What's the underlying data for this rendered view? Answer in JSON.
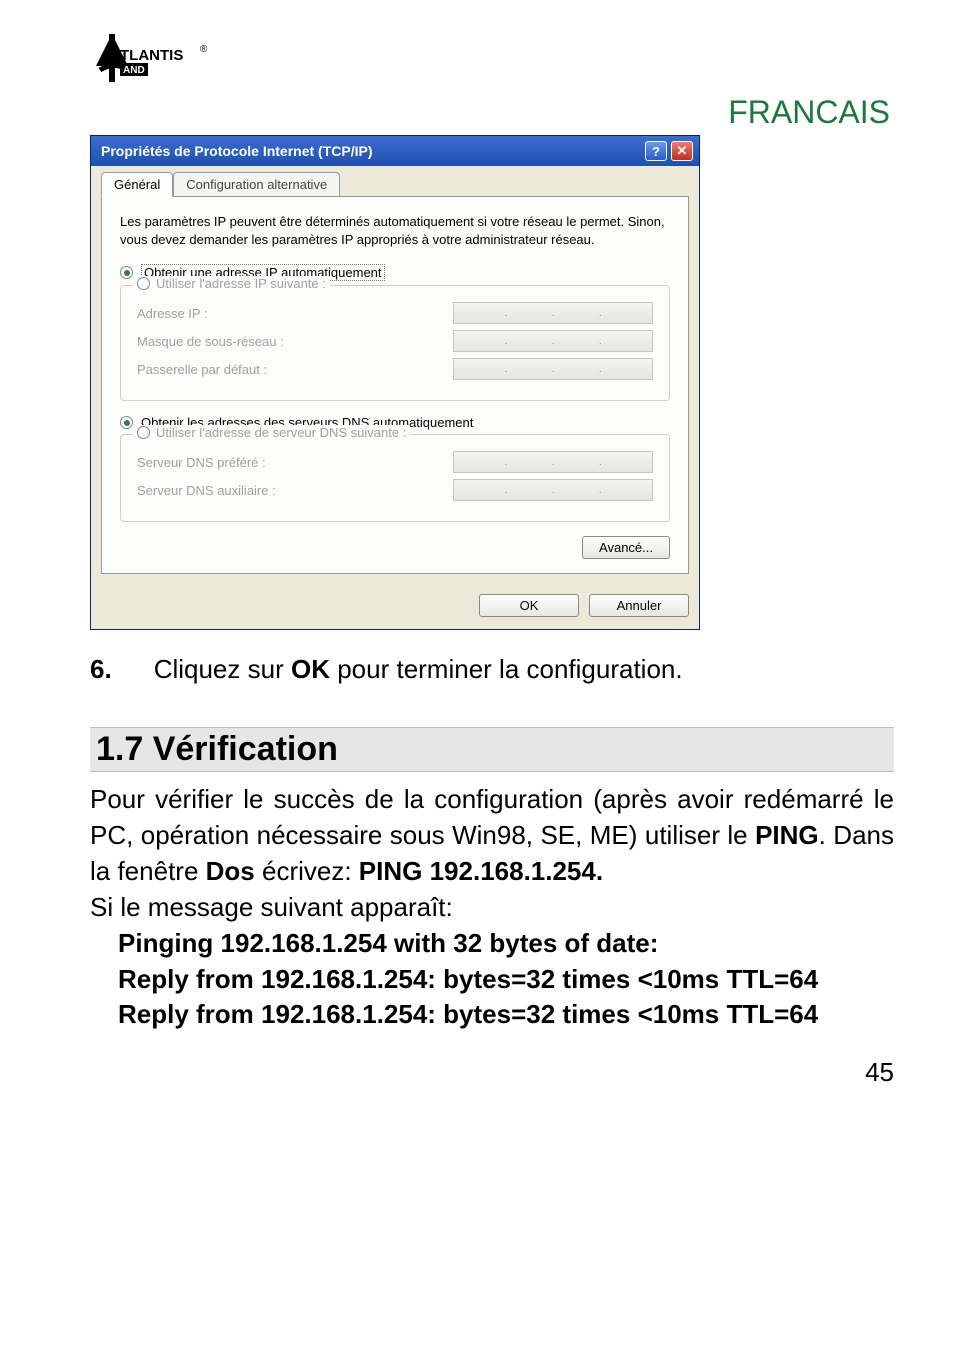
{
  "header": {
    "brand_word": "FRANCAIS"
  },
  "logo": {
    "text_top": "TLANTIS",
    "text_reg": "®",
    "text_sub": "AND"
  },
  "dialog": {
    "title": "Propriétés de Protocole Internet (TCP/IP)",
    "help_glyph": "?",
    "close_glyph": "✕",
    "tabs": {
      "general": "Général",
      "alt": "Configuration alternative"
    },
    "description": "Les paramètres IP peuvent être déterminés automatiquement si votre réseau le permet. Sinon, vous devez demander les paramètres IP appropriés à votre administrateur réseau.",
    "radios": {
      "obtain_ip": "Obtenir une adresse IP automatiquement",
      "use_ip": "Utiliser l'adresse IP suivante :",
      "obtain_dns": "Obtenir les adresses des serveurs DNS automatiquement",
      "use_dns": "Utiliser l'adresse de serveur DNS suivante :"
    },
    "fields": {
      "ip_addr": "Adresse IP :",
      "mask": "Masque de sous-réseau :",
      "gateway": "Passerelle par défaut :",
      "dns_pref": "Serveur DNS préféré :",
      "dns_aux": "Serveur DNS auxiliaire :"
    },
    "buttons": {
      "advanced": "Avancé...",
      "ok": "OK",
      "cancel": "Annuler"
    }
  },
  "doc": {
    "step_num": "6.",
    "step_pre": "Cliquez sur ",
    "step_bold": " OK ",
    "step_post": "pour terminer la configuration.",
    "section_title": "1.7 Vérification",
    "para1_a": "Pour vérifier le succès de la configuration (après avoir redémarré le PC, opération nécessaire sous Win98, SE, ME) utiliser le ",
    "para1_b": "PING",
    "para1_c": ". Dans la fenêtre ",
    "para1_d": "Dos",
    "para1_e": " écrivez: ",
    "para1_f": "PING 192.168.1.254.",
    "para2": "Si le message suivant apparaît:",
    "code1": "Pinging 192.168.1.254 with 32 bytes of date:",
    "code2": "Reply from 192.168.1.254: bytes=32 times <10ms TTL=64",
    "code3": "Reply from 192.168.1.254: bytes=32 times <10ms TTL=64",
    "page_number": "45"
  }
}
